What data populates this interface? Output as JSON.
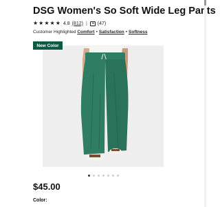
{
  "product": {
    "title": "DSG Women's So Soft Wide Leg Pants",
    "rating_value": "4.8",
    "review_count": "(812)",
    "separator": "|",
    "qa_count": "(47)",
    "stars_rating": 4.8,
    "stars_max": 5
  },
  "highlights": {
    "prefix": "Customer Highlighted",
    "items": [
      "Comfort",
      "Satisfaction",
      "Softness"
    ],
    "separator": "•"
  },
  "badge": {
    "label": "New Color"
  },
  "image": {
    "pants_color": "#2f7d63",
    "background_color": "#eeeeee",
    "shirt_color": "#f5f5f3"
  },
  "carousel": {
    "total": 7,
    "active_index": 0
  },
  "price": "$45.00",
  "color_label": "Color:",
  "colors": {
    "badge": "#0f5a45"
  }
}
